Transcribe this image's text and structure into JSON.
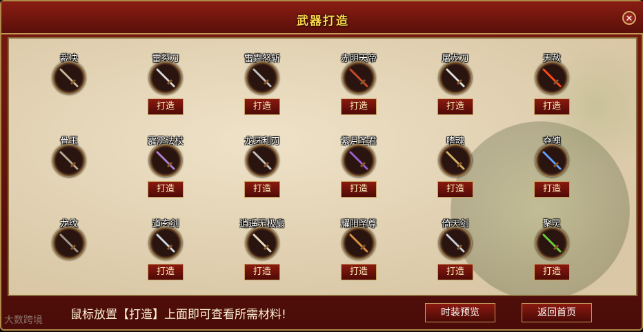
{
  "title": "武器打造",
  "hint": "鼠标放置【打造】上面即可查看所需材料!",
  "footer_buttons": {
    "preview": "时装预览",
    "home": "返回首页"
  },
  "watermark": "大数跨境",
  "weapons": [
    {
      "row": 0,
      "col": 0,
      "name": "裁决",
      "color": "#c9b79a",
      "forge": null
    },
    {
      "row": 0,
      "col": 1,
      "name": "雷裂刀",
      "color": "#d8d8d8",
      "forge": "打造"
    },
    {
      "row": 0,
      "col": 2,
      "name": "雷霆怒斩",
      "color": "#c0c0c0",
      "forge": "打造"
    },
    {
      "row": 0,
      "col": 3,
      "name": "赤明天帝",
      "color": "#c84a2a",
      "forge": "打造"
    },
    {
      "row": 0,
      "col": 4,
      "name": "屠龙刀",
      "color": "#e0e0e0",
      "forge": "打造"
    },
    {
      "row": 0,
      "col": 5,
      "name": "无赦",
      "color": "#ff4a1a",
      "forge": "打造"
    },
    {
      "row": 1,
      "col": 0,
      "name": "骨玉",
      "color": "#b8a890",
      "forge": null
    },
    {
      "row": 1,
      "col": 1,
      "name": "霹雳法杖",
      "color": "#b080d0",
      "forge": "打造"
    },
    {
      "row": 1,
      "col": 2,
      "name": "龙牙利刃",
      "color": "#c0c0c0",
      "forge": "打造"
    },
    {
      "row": 1,
      "col": 3,
      "name": "紫月圣君",
      "color": "#9a60d0",
      "forge": "打造"
    },
    {
      "row": 1,
      "col": 4,
      "name": "嗜魂",
      "color": "#d4b060",
      "forge": "打造"
    },
    {
      "row": 1,
      "col": 5,
      "name": "夺魄",
      "color": "#60a0ff",
      "forge": "打造"
    },
    {
      "row": 2,
      "col": 0,
      "name": "龙纹",
      "color": "#a09888",
      "forge": null
    },
    {
      "row": 2,
      "col": 1,
      "name": "道玄剑",
      "color": "#d0d8e0",
      "forge": "打造"
    },
    {
      "row": 2,
      "col": 2,
      "name": "逍遥无极扇",
      "color": "#e8dcc0",
      "forge": "打造"
    },
    {
      "row": 2,
      "col": 3,
      "name": "耀阳圣尊",
      "color": "#d89040",
      "forge": "打造"
    },
    {
      "row": 2,
      "col": 4,
      "name": "倚天剑",
      "color": "#c8d0d8",
      "forge": "打造"
    },
    {
      "row": 2,
      "col": 5,
      "name": "聚灵",
      "color": "#6ad03a",
      "forge": "打造"
    }
  ]
}
